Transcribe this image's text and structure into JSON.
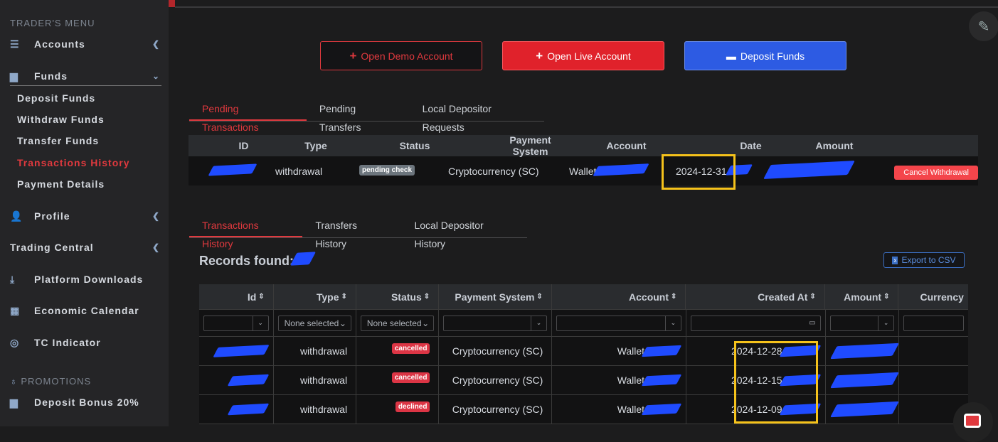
{
  "sidebar": {
    "heading": "TRADER'S MENU",
    "accounts": "Accounts",
    "funds": "Funds",
    "funds_sub": [
      "Deposit Funds",
      "Withdraw Funds",
      "Transfer Funds",
      "Transactions History",
      "Payment Details"
    ],
    "profile": "Profile",
    "trading_central": "Trading Central",
    "platform_downloads": "Platform Downloads",
    "economic_calendar": "Economic Calendar",
    "tc_indicator": "TC Indicator",
    "promotions_heading": "PROMOTIONS",
    "deposit_bonus": "Deposit Bonus 20%"
  },
  "actions": {
    "open_demo": "Open Demo Account",
    "open_live": "Open Live Account",
    "deposit": "Deposit Funds"
  },
  "pending_tabs": [
    "Pending Transactions",
    "Pending Transfers",
    "Local Depositor Requests"
  ],
  "pending_table": {
    "headers": [
      "ID",
      "Type",
      "Status",
      "Payment System",
      "Account",
      "Date",
      "Amount"
    ],
    "row": {
      "type": "withdrawal",
      "status": "pending check",
      "payment_system": "Cryptocurrency (SC)",
      "account": "Wallet",
      "date": "2024-12-31",
      "action": "Cancel Withdrawal"
    }
  },
  "history_tabs": [
    "Transactions History",
    "Transfers History",
    "Local Depositor History"
  ],
  "records_label": "Records found:",
  "export_label": "Export to CSV",
  "history_table": {
    "headers": [
      "Id",
      "Type",
      "Status",
      "Payment System",
      "Account",
      "Created At",
      "Amount",
      "Currency"
    ],
    "filter_placeholder": "None selected",
    "rows": [
      {
        "type": "withdrawal",
        "status": "cancelled",
        "payment_system": "Cryptocurrency (SC)",
        "account": "Wallet",
        "created_at": "2024-12-28"
      },
      {
        "type": "withdrawal",
        "status": "cancelled",
        "payment_system": "Cryptocurrency (SC)",
        "account": "Wallet",
        "created_at": "2024-12-15"
      },
      {
        "type": "withdrawal",
        "status": "declined",
        "payment_system": "Cryptocurrency (SC)",
        "account": "Wallet",
        "created_at": "2024-12-09"
      }
    ]
  },
  "colors": {
    "accent": "#e0393e",
    "primary": "#2d5be3",
    "redaction": "#1f4bff",
    "highlight": "#f5c21b"
  }
}
